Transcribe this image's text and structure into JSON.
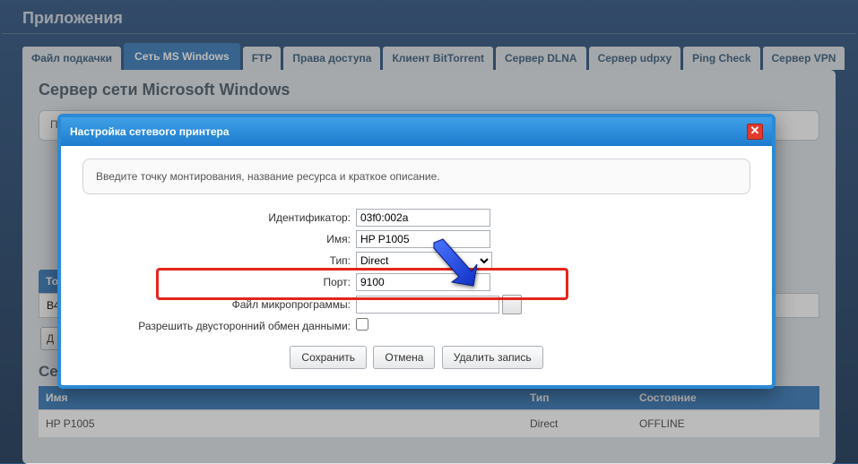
{
  "page_title": "Приложения",
  "tabs": [
    {
      "label": "Файл подкачки"
    },
    {
      "label": "Сеть MS Windows",
      "active": true
    },
    {
      "label": "FTP"
    },
    {
      "label": "Права доступа"
    },
    {
      "label": "Клиент BitTorrent"
    },
    {
      "label": "Сервер DLNA"
    },
    {
      "label": "Сервер udpxy"
    },
    {
      "label": "Ping Check"
    },
    {
      "label": "Сервер VPN"
    }
  ],
  "panel": {
    "title": "Сервер сети Microsoft Windows",
    "visible_prefix": "П",
    "sub_table_header": "То",
    "sub_table_row": "B4",
    "add_btn_prefix": "Д"
  },
  "printers": {
    "section_title": "Сетевые принтеры",
    "headers": {
      "name": "Имя",
      "type": "Тип",
      "state": "Состояние"
    },
    "rows": [
      {
        "name": "HP P1005",
        "type": "Direct",
        "state": "OFFLINE"
      }
    ]
  },
  "modal": {
    "title": "Настройка сетевого принтера",
    "hint": "Введите точку монтирования, название ресурса и краткое описание.",
    "fields": {
      "id_label": "Идентификатор:",
      "id_value": "03f0:002a",
      "name_label": "Имя:",
      "name_value": "HP P1005",
      "type_label": "Тип:",
      "type_value": "Direct",
      "port_label": "Порт:",
      "port_value": "9100",
      "fw_label": "Файл микропрограммы:",
      "fw_value": "",
      "bidir_label": "Разрешить двусторонний обмен данными:"
    },
    "buttons": {
      "save": "Сохранить",
      "cancel": "Отмена",
      "delete": "Удалить запись"
    }
  }
}
